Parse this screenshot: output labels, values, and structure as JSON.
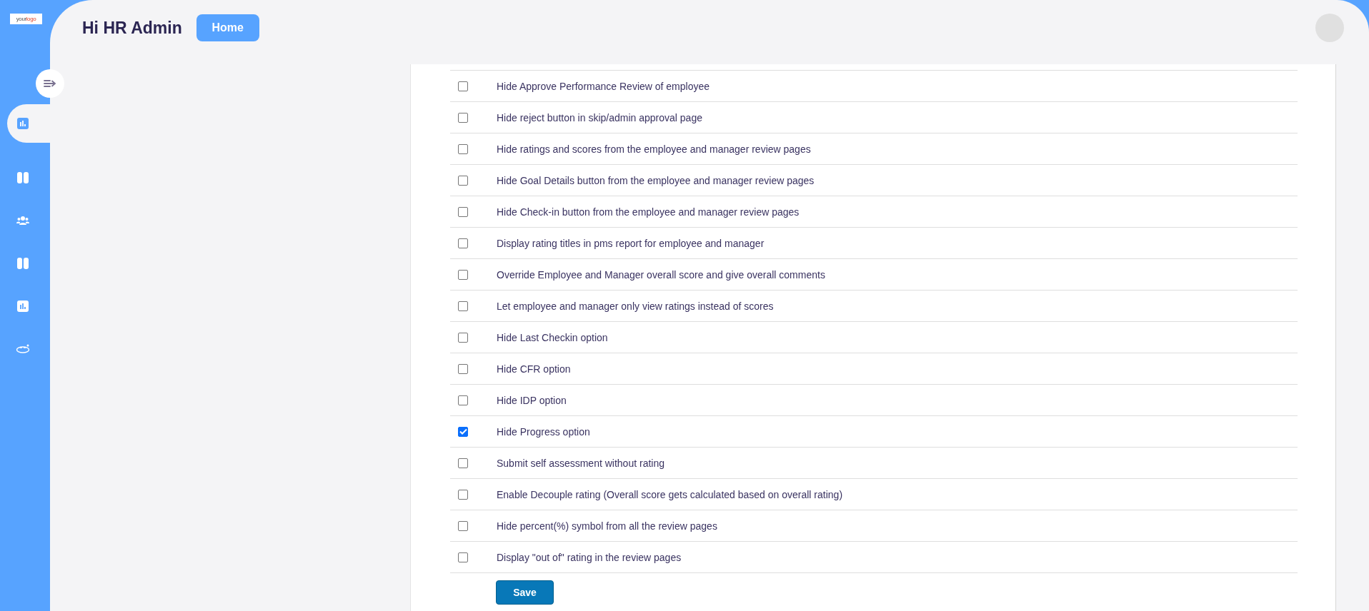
{
  "logo": {
    "part_1": "your",
    "part_2": "logo"
  },
  "sidebar": {
    "items": [
      {
        "kind": "chart",
        "selected": true
      },
      {
        "kind": "panel",
        "selected": false
      },
      {
        "kind": "people",
        "selected": false
      },
      {
        "kind": "panel",
        "selected": false
      },
      {
        "kind": "chart",
        "selected": false
      },
      {
        "kind": "rotation",
        "selected": false
      }
    ]
  },
  "header": {
    "greeting": "Hi HR Admin",
    "home_button": "Home"
  },
  "settings": [
    {
      "label": "Hide Approve Performance Review of employee",
      "checked": false
    },
    {
      "label": "Hide reject button in skip/admin approval page",
      "checked": false
    },
    {
      "label": "Hide ratings and scores from the employee and manager review pages",
      "checked": false
    },
    {
      "label": "Hide Goal Details button from the employee and manager review pages",
      "checked": false
    },
    {
      "label": "Hide Check-in button from the employee and manager review pages",
      "checked": false
    },
    {
      "label": "Display rating titles in pms report for employee and manager",
      "checked": false
    },
    {
      "label": "Override Employee and Manager overall score and give overall comments",
      "checked": false
    },
    {
      "label": "Let employee and manager only view ratings instead of scores",
      "checked": false
    },
    {
      "label": "Hide Last Checkin option",
      "checked": false
    },
    {
      "label": "Hide CFR option",
      "checked": false
    },
    {
      "label": "Hide IDP option",
      "checked": false
    },
    {
      "label": "Hide Progress option",
      "checked": true
    },
    {
      "label": "Submit self assessment without rating",
      "checked": false
    },
    {
      "label": "Enable Decouple rating (Overall score gets calculated based on overall rating)",
      "checked": false
    },
    {
      "label": "Hide percent(%) symbol from all the review pages",
      "checked": false
    },
    {
      "label": "Display \"out of\" rating in the review pages",
      "checked": false
    }
  ],
  "save_button": "Save"
}
